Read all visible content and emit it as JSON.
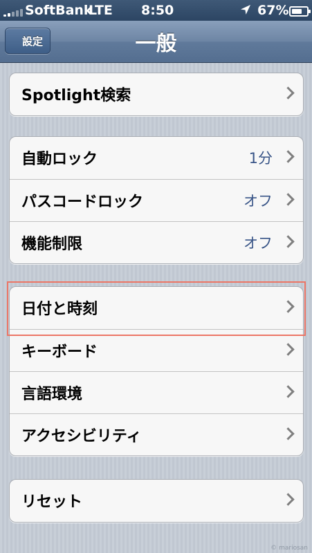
{
  "status_bar": {
    "carrier": "SoftBank",
    "network": "LTE",
    "time": "8:50",
    "battery_percent": "67%",
    "icons": [
      "signal-icon",
      "location-arrow-icon",
      "battery-icon"
    ]
  },
  "nav": {
    "back_label": "設定",
    "title": "一般"
  },
  "groups": [
    {
      "rows": [
        {
          "label": "Spotlight検索",
          "value": ""
        }
      ]
    },
    {
      "rows": [
        {
          "label": "自動ロック",
          "value": "1分"
        },
        {
          "label": "パスコードロック",
          "value": "オフ"
        },
        {
          "label": "機能制限",
          "value": "オフ"
        }
      ]
    },
    {
      "rows": [
        {
          "label": "日付と時刻",
          "value": ""
        },
        {
          "label": "キーボード",
          "value": ""
        },
        {
          "label": "言語環境",
          "value": ""
        },
        {
          "label": "アクセシビリティ",
          "value": ""
        }
      ]
    },
    {
      "rows": [
        {
          "label": "リセット",
          "value": ""
        }
      ]
    }
  ],
  "colors": {
    "value_text": "#385487",
    "highlight_border": "#ec7565"
  },
  "watermark": "© mariosan"
}
